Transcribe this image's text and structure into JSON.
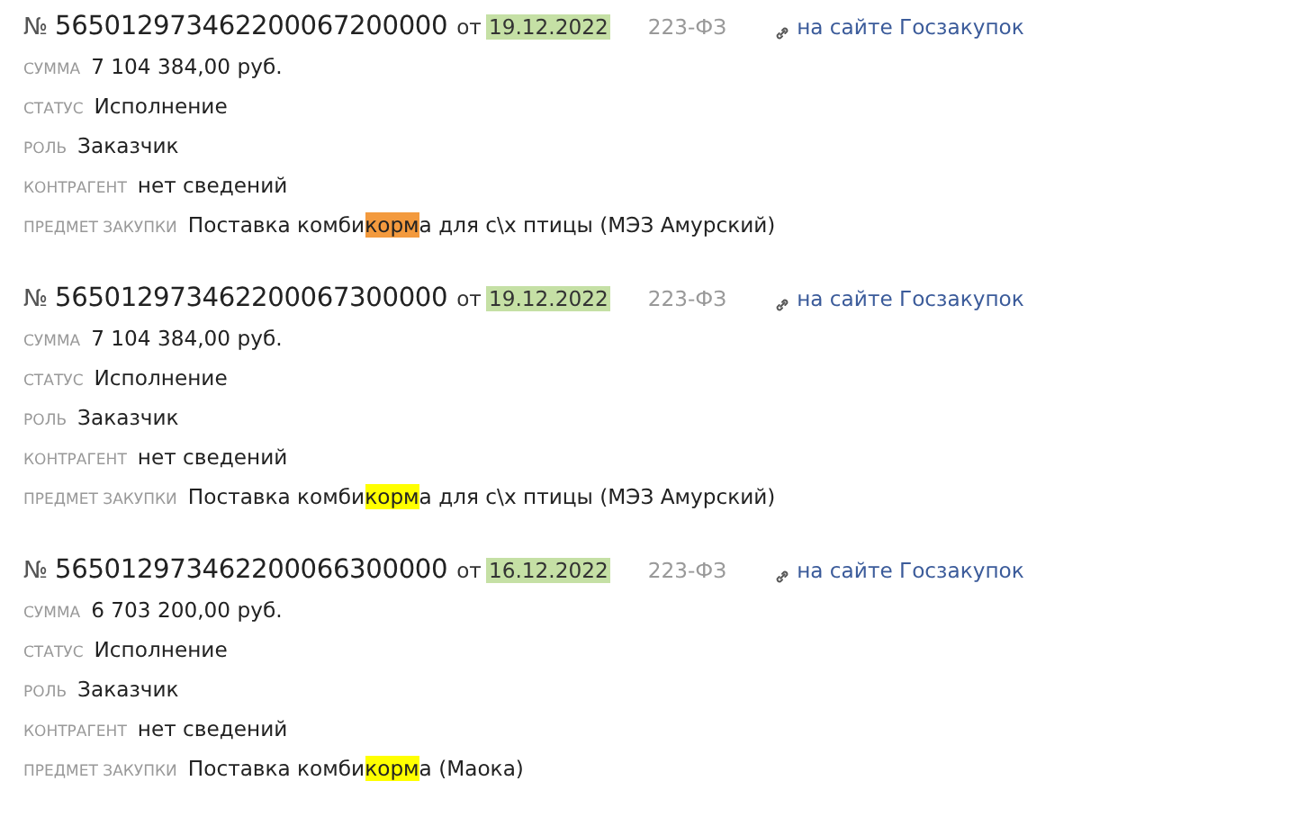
{
  "contracts": [
    {
      "number_sign": "№",
      "number": "565012973462200067200000",
      "from": "от",
      "date": "19.12.2022",
      "law": "223-ФЗ",
      "link": "на сайте Госзакупок",
      "fields": [
        {
          "label": "СУММА",
          "value": "7 104 384,00 руб."
        },
        {
          "label": "СТАТУС",
          "value": "Исполнение"
        },
        {
          "label": "РОЛЬ",
          "value": "Заказчик"
        },
        {
          "label": "КОНТРАГЕНТ",
          "value": "нет сведений"
        }
      ],
      "subject_label": "ПРЕДМЕТ ЗАКУПКИ",
      "subject": [
        {
          "text": "Поставка комби",
          "highlight": false
        },
        {
          "text": "корм",
          "highlight": true,
          "color": "#f39a3e"
        },
        {
          "text": "а для с\\х птицы (МЭЗ Амурский)",
          "highlight": false
        }
      ]
    },
    {
      "number_sign": "№",
      "number": "565012973462200067300000",
      "from": "от",
      "date": "19.12.2022",
      "law": "223-ФЗ",
      "link": "на сайте Госзакупок",
      "fields": [
        {
          "label": "СУММА",
          "value": "7 104 384,00 руб."
        },
        {
          "label": "СТАТУС",
          "value": "Исполнение"
        },
        {
          "label": "РОЛЬ",
          "value": "Заказчик"
        },
        {
          "label": "КОНТРАГЕНТ",
          "value": "нет сведений"
        }
      ],
      "subject_label": "ПРЕДМЕТ ЗАКУПКИ",
      "subject": [
        {
          "text": "Поставка комби",
          "highlight": false
        },
        {
          "text": "корм",
          "highlight": true,
          "color": "#ffff00"
        },
        {
          "text": "а для с\\х птицы (МЭЗ Амурский)",
          "highlight": false
        }
      ]
    },
    {
      "number_sign": "№",
      "number": "565012973462200066300000",
      "from": "от",
      "date": "16.12.2022",
      "law": "223-ФЗ",
      "link": "на сайте Госзакупок",
      "fields": [
        {
          "label": "СУММА",
          "value": "6 703 200,00 руб."
        },
        {
          "label": "СТАТУС",
          "value": "Исполнение"
        },
        {
          "label": "РОЛЬ",
          "value": "Заказчик"
        },
        {
          "label": "КОНТРАГЕНТ",
          "value": "нет сведений"
        }
      ],
      "subject_label": "ПРЕДМЕТ ЗАКУПКИ",
      "subject": [
        {
          "text": "Поставка комби",
          "highlight": false
        },
        {
          "text": "корм",
          "highlight": true,
          "color": "#ffff00"
        },
        {
          "text": "а (Маока)",
          "highlight": false
        }
      ]
    }
  ]
}
